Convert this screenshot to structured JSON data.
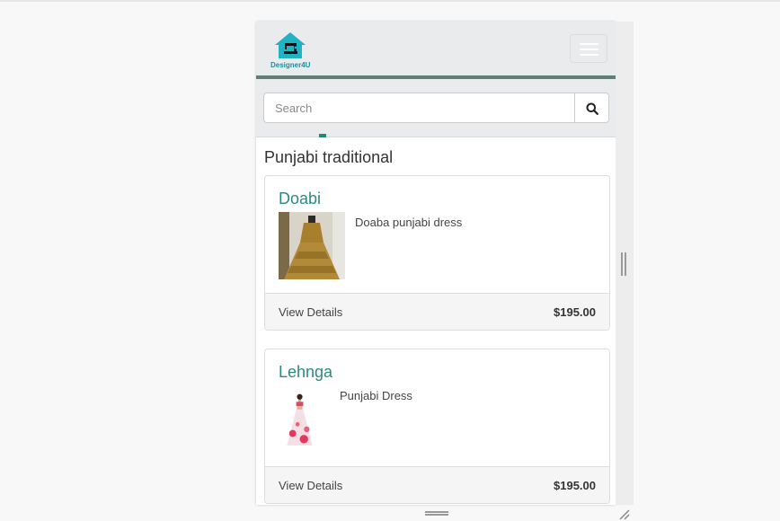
{
  "navbar": {
    "brand_text": "Designer4U",
    "menu_toggle_icon": "hamburger-menu-icon"
  },
  "search": {
    "placeholder": "Search",
    "value": "",
    "button_icon": "search-icon"
  },
  "section": {
    "title": "Punjabi traditional"
  },
  "products": [
    {
      "title": "Doabi",
      "description": "Doaba punjabi dress",
      "view_label": "View Details",
      "price": "$195.00"
    },
    {
      "title": "Lehnga",
      "description": "Punjabi Dress",
      "view_label": "View Details",
      "price": "$195.00"
    }
  ],
  "colors": {
    "accent": "#2a8a7e",
    "navbar_border": "#5f7f72",
    "navbar_bg": "#e9ebec",
    "logo_house": "#1fb3c4"
  }
}
